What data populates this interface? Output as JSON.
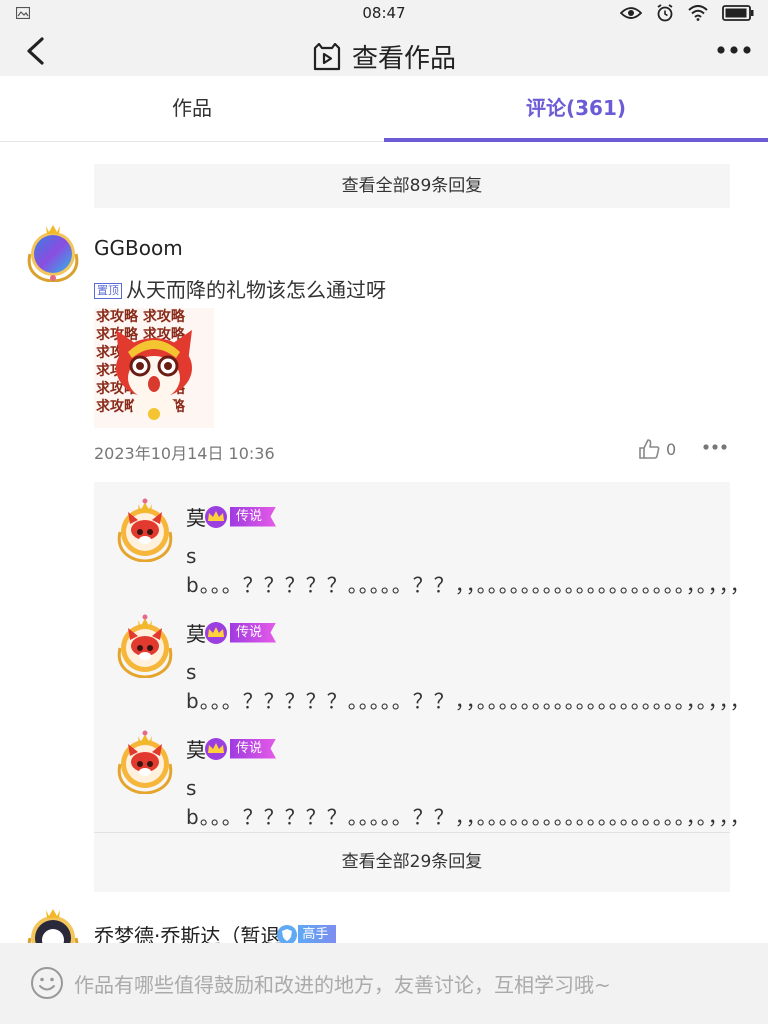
{
  "status_bar": {
    "time": "08:47"
  },
  "header": {
    "title": "查看作品"
  },
  "tabs": {
    "works": "作品",
    "comments": "评论(361)"
  },
  "top_view_all": "查看全部89条回复",
  "comment1": {
    "username": "GGBoom",
    "pin_label": "置顶",
    "text": "从天而降的礼物该怎么通过呀",
    "sticker_text": "求攻略 求攻略\n求攻略 求攻略\n求攻略 求攻略\n求攻略 求攻略\n求攻略 求攻略\n求攻略 求攻略",
    "date": "2023年10月14日 10:36",
    "likes": "0",
    "replies": [
      {
        "name": "莫",
        "badge": "传说",
        "text": "sb。。。？？？？？。。。。。？？，，。。。。。。。。。。。。。。。。。。。，。，，，"
      },
      {
        "name": "莫",
        "badge": "传说",
        "text": "sb。。。？？？？？。。。。。？？，，。。。。。。。。。。。。。。。。。。。，。，，，"
      },
      {
        "name": "莫",
        "badge": "传说",
        "text": "sb。。。？？？？？。。。。。？？，，。。。。。。。。。。。。。。。。。。。，。，，，"
      }
    ],
    "view_all_replies": "查看全部29条回复"
  },
  "comment2": {
    "username": "乔梦德·乔斯达（暂退",
    "badge": "高手"
  },
  "bottom_bar": {
    "placeholder": "作品有哪些值得鼓励和改进的地方，友善讨论，互相学习哦~"
  },
  "colors": {
    "accent": "#6b5bd6",
    "legend_badge": "#c04be6",
    "expert_badge": "#6a9cf2"
  },
  "icons": [
    "gallery-icon",
    "eye-icon",
    "alarm-icon",
    "wifi-icon",
    "battery-icon",
    "back-arrow-icon",
    "video-play-icon",
    "more-dots-icon",
    "thumbs-up-icon",
    "crown-icon",
    "smiley-icon"
  ]
}
